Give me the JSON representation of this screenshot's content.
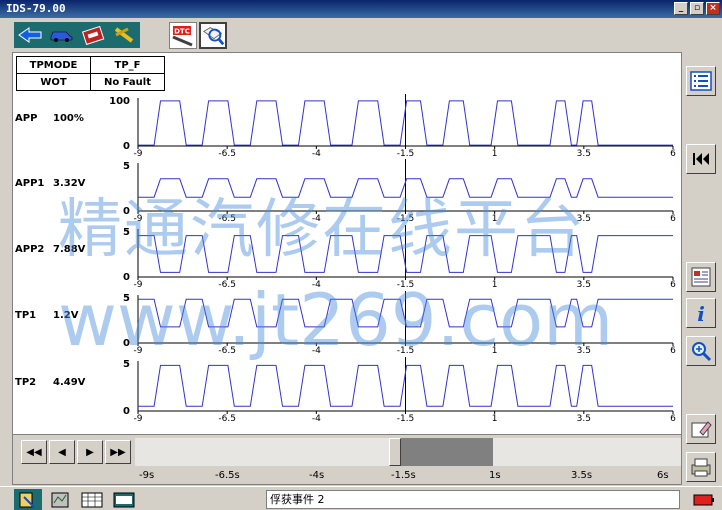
{
  "window": {
    "title": "IDS-79.00"
  },
  "toolbar": {
    "nav_icons": [
      "back-arrow-icon",
      "vehicle-icon",
      "toolbox-icon",
      "tools-icon"
    ],
    "mode_icons": [
      "dtc-icon",
      "datalogger-icon"
    ]
  },
  "pid_table": {
    "headers": [
      "TPMODE",
      "TP_F"
    ],
    "values": [
      "WOT",
      "No Fault"
    ]
  },
  "colors": {
    "trace": "#3333cc",
    "axis": "#000000",
    "watermark": "#4a90e0"
  },
  "traces": [
    {
      "name": "APP",
      "value": "100%",
      "ymax": "100",
      "ymin": "0"
    },
    {
      "name": "APP1",
      "value": "3.32V",
      "ymax": "5",
      "ymin": "0"
    },
    {
      "name": "APP2",
      "value": "7.88V",
      "ymax": "5",
      "ymin": "0"
    },
    {
      "name": "TP1",
      "value": "1.2V",
      "ymax": "5",
      "ymin": "0"
    },
    {
      "name": "TP2",
      "value": "4.49V",
      "ymax": "5",
      "ymin": "0"
    }
  ],
  "x_ticks": [
    "-9",
    "-6.5",
    "-4",
    "-1.5",
    "1",
    "3.5",
    "6"
  ],
  "timeline": {
    "labels": [
      "-9s",
      "-6.5s",
      "-4s",
      "-1.5s",
      "1s",
      "3.5s",
      "6s"
    ]
  },
  "playback": {
    "rewind": "◀◀",
    "step_back": "◀",
    "step_forward": "▶",
    "fast_forward": "▶▶"
  },
  "status": {
    "text": "俘获事件 2"
  },
  "watermark": {
    "line1": "精通汽修在线平台",
    "line2": "www.jt269.com"
  }
}
